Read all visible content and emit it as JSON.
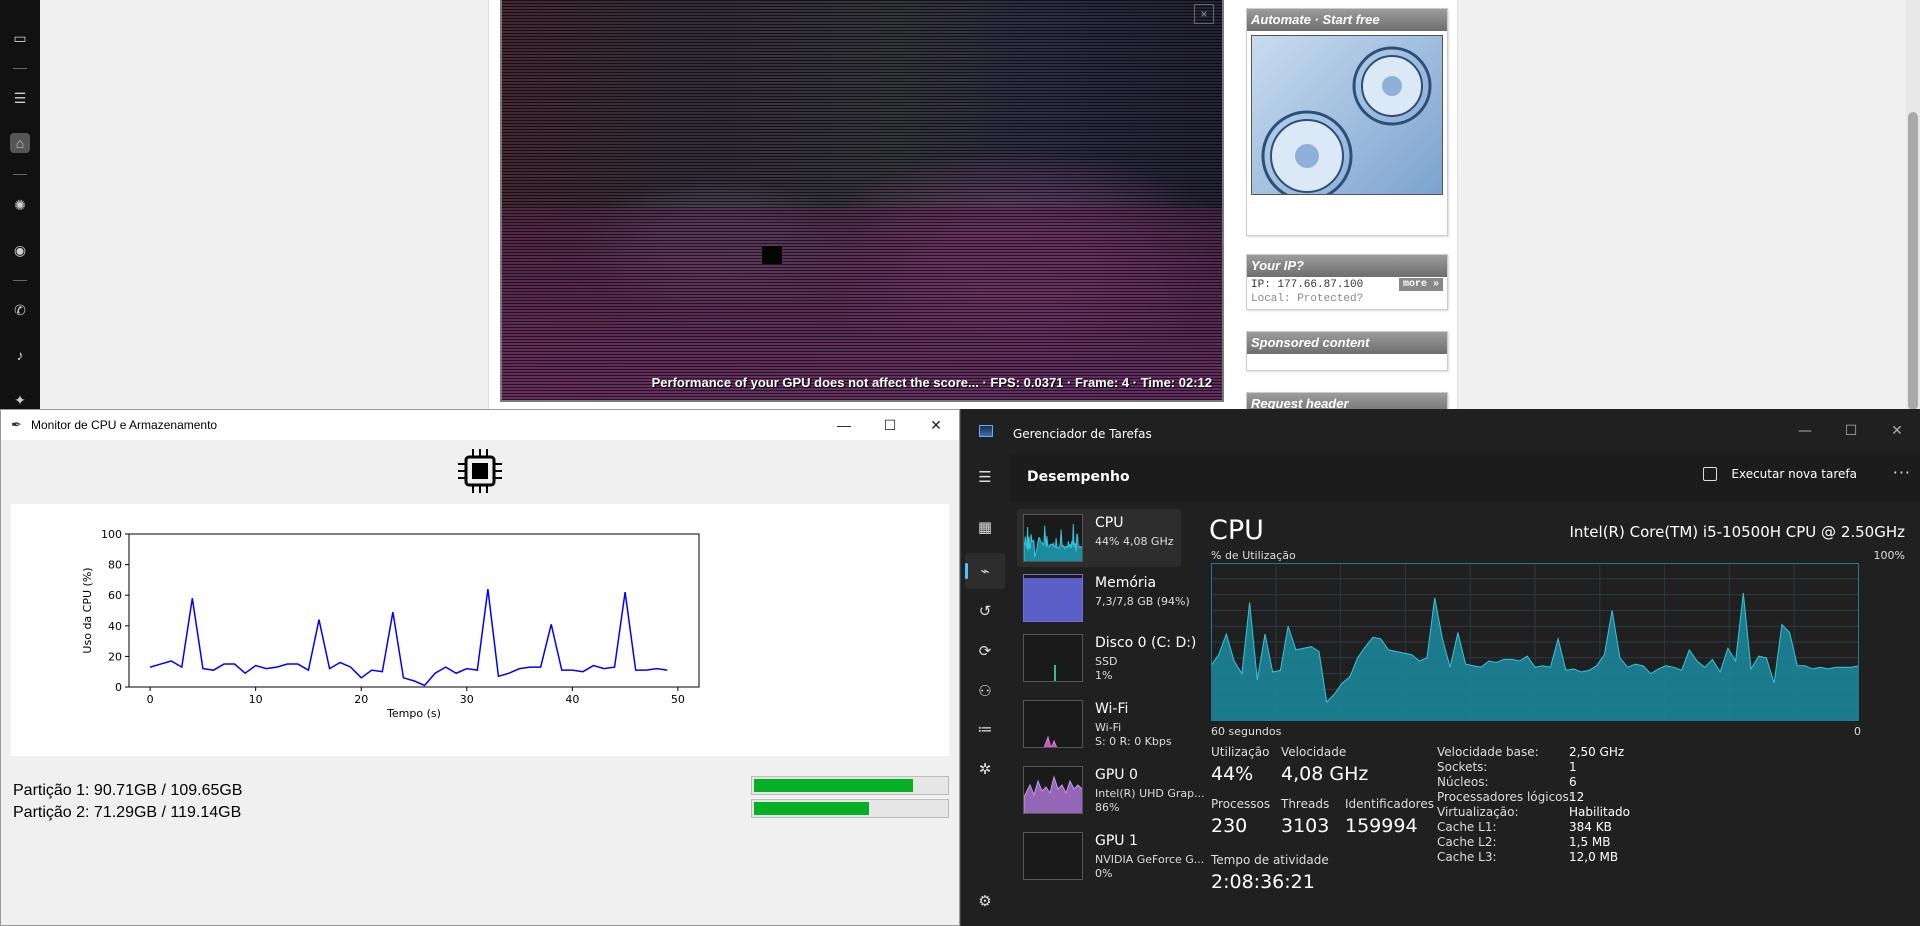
{
  "browser": {
    "gpu_status": "Performance of your GPU does not affect the score... · FPS: 0.0371 · Frame: 4 · Time: 02:12",
    "close_glyph": "×",
    "widgets": {
      "automate_title": "Automate · Start free",
      "ip_title": "Your IP?",
      "ip_line": "IP: 177.66.87.100",
      "ip_local": "Local: Protected?",
      "ip_more": "more »",
      "sponsored_title": "Sponsored content",
      "request_title": "Request header"
    },
    "rail_icons": [
      "briefcase-icon",
      "list-icon",
      "home-icon",
      "chatgpt-icon",
      "codeshare-icon",
      "whatsapp-icon",
      "tiktok-icon",
      "twitter-icon"
    ]
  },
  "monitor": {
    "title": "Monitor de CPU e Armazenamento",
    "ylabel": "Uso da CPU (%)",
    "xlabel": "Tempo (s)",
    "partitions": [
      {
        "label": "Partição 1: 90.71GB / 109.65GB",
        "fraction": 0.827
      },
      {
        "label": "Partição 2: 71.29GB / 119.14GB",
        "fraction": 0.598
      }
    ]
  },
  "chart_data": {
    "type": "line",
    "xlabel": "Tempo (s)",
    "ylabel": "Uso da CPU (%)",
    "xlim": [
      -2,
      52
    ],
    "ylim": [
      0,
      100
    ],
    "xticks": [
      0,
      10,
      20,
      30,
      40,
      50
    ],
    "yticks": [
      0,
      20,
      40,
      60,
      80,
      100
    ],
    "series": [
      {
        "color": "#0000ff",
        "x": [
          0,
          1,
          2,
          3,
          4,
          5,
          6,
          7,
          8,
          9,
          10,
          11,
          12,
          13,
          14,
          15,
          16,
          17,
          18,
          19,
          20,
          21,
          22,
          23,
          24,
          25,
          26,
          27,
          28,
          29,
          30,
          31,
          32,
          33,
          34,
          35,
          36,
          37,
          38,
          39,
          40,
          41,
          42,
          43,
          44,
          45,
          46,
          47,
          48,
          49
        ],
        "y": [
          13,
          15,
          17,
          13,
          58,
          12,
          11,
          15,
          15,
          9,
          14,
          12,
          13,
          15,
          15,
          11,
          44,
          12,
          16,
          13,
          6,
          11,
          10,
          49,
          6,
          4,
          1,
          9,
          13,
          9,
          12,
          11,
          64,
          7,
          9,
          12,
          13,
          13,
          41,
          11,
          11,
          10,
          14,
          12,
          13,
          62,
          11,
          11,
          12,
          11
        ]
      }
    ]
  },
  "taskmgr": {
    "title": "Gerenciador de Tarefas",
    "section": "Desempenho",
    "run_task": "Executar nova tarefa",
    "more": "···",
    "devices": [
      {
        "name": "CPU",
        "sub1": "44%  4,08 GHz",
        "sub2": ""
      },
      {
        "name": "Memória",
        "sub1": "7,3/7,8 GB (94%)",
        "sub2": ""
      },
      {
        "name": "Disco 0 (C: D:)",
        "sub1": "SSD",
        "sub2": "1%"
      },
      {
        "name": "Wi-Fi",
        "sub1": "Wi-Fi",
        "sub2": "S: 0  R: 0 Kbps"
      },
      {
        "name": "GPU 0",
        "sub1": "Intel(R) UHD Grap...",
        "sub2": "86%"
      },
      {
        "name": "GPU 1",
        "sub1": "NVIDIA GeForce G...",
        "sub2": "0%"
      }
    ],
    "cpu_title": "CPU",
    "cpu_model": "Intel(R) Core(TM) i5-10500H CPU @ 2.50GHz",
    "util_label": "% de Utilização",
    "max_label": "100%",
    "span_label": "60 segundos",
    "zero_label": "0",
    "stats": {
      "util_l": "Utilização",
      "util_v": "44%",
      "speed_l": "Velocidade",
      "speed_v": "4,08 GHz",
      "proc_l": "Processos",
      "proc_v": "230",
      "threads_l": "Threads",
      "threads_v": "3103",
      "handles_l": "Identificadores",
      "handles_v": "159994",
      "uptime_l": "Tempo de atividade",
      "uptime_v": "2:08:36:21"
    },
    "specs": [
      {
        "k": "Velocidade base:",
        "v": "2,50 GHz"
      },
      {
        "k": "Sockets:",
        "v": "1"
      },
      {
        "k": "Núcleos:",
        "v": "6"
      },
      {
        "k": "Processadores lógicos:",
        "v": "12"
      },
      {
        "k": "Virtualização:",
        "v": "Habilitado"
      },
      {
        "k": "Cache L1:",
        "v": "384 KB"
      },
      {
        "k": "Cache L2:",
        "v": "1,5 MB"
      },
      {
        "k": "Cache L3:",
        "v": "12,0 MB"
      }
    ],
    "cpu_history": [
      35,
      42,
      55,
      38,
      30,
      75,
      26,
      55,
      31,
      32,
      60,
      45,
      46,
      47,
      44,
      12,
      17,
      24,
      28,
      40,
      47,
      53,
      52,
      45,
      44,
      43,
      42,
      38,
      40,
      78,
      52,
      34,
      56,
      36,
      35,
      34,
      38,
      37,
      39,
      39,
      38,
      41,
      34,
      35,
      34,
      52,
      32,
      33,
      31,
      32,
      35,
      42,
      70,
      40,
      34,
      36,
      35,
      30,
      33,
      35,
      34,
      32,
      45,
      38,
      34,
      39,
      31,
      46,
      38,
      81,
      33,
      41,
      40,
      24,
      61,
      56,
      35,
      35,
      33,
      34,
      33,
      34,
      34,
      34,
      35
    ]
  }
}
